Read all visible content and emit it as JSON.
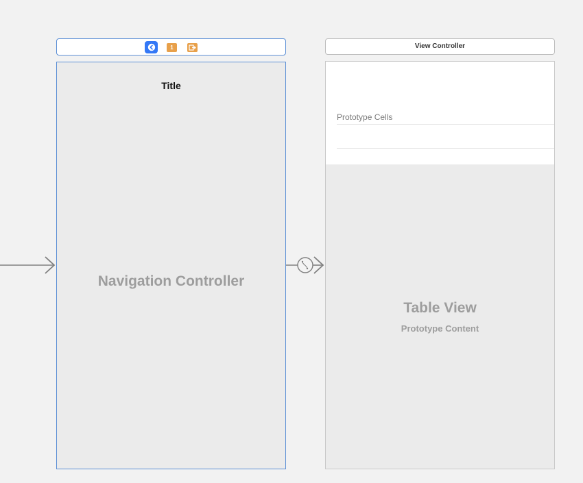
{
  "navigation_scene": {
    "bar_title": "Title",
    "placeholder_label": "Navigation Controller",
    "dock": {
      "icons": [
        "back-controller-icon",
        "first-responder-icon",
        "exit-icon"
      ],
      "first_responder_glyph": "1"
    }
  },
  "view_controller_scene": {
    "dock_title": "View Controller",
    "prototype_cells_header": "Prototype Cells",
    "table_title": "Table View",
    "table_subtitle": "Prototype Content"
  },
  "connections": {
    "segue_icon": "relationship-segue-icon"
  },
  "colors": {
    "canvas_background": "#f2f2f2",
    "selection_outline": "#5b8fd6",
    "dock_back_icon": "#3478f6",
    "dock_orange_icons": "#e8a04a",
    "scene_background": "#ebebeb",
    "placeholder_text": "#9d9d9d"
  }
}
